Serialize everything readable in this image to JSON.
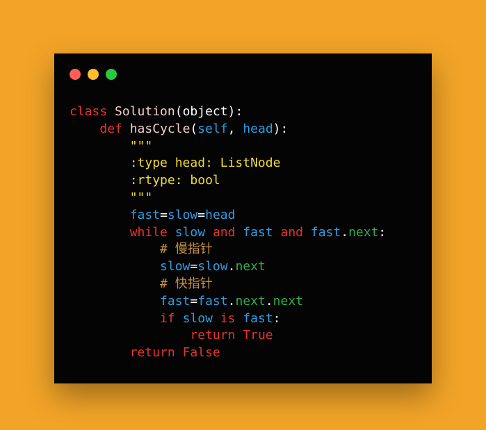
{
  "colors": {
    "background": "#f2a428",
    "window": "#050404",
    "dot_red": "#ff5f57",
    "dot_yellow": "#febc2e",
    "dot_green": "#28c840"
  },
  "code_lines": [
    [
      "class",
      " ",
      "Solution",
      "(",
      "object",
      "):"
    ],
    [
      "    ",
      "def",
      " ",
      "hasCycle",
      "(",
      "self",
      ", ",
      "head",
      "):"
    ],
    [
      "        ",
      "\"\"\""
    ],
    [
      "        ",
      ":type head: ListNode"
    ],
    [
      "        ",
      ":rtype: bool"
    ],
    [
      "        ",
      "\"\"\""
    ],
    [
      "        ",
      "fast",
      "=",
      "slow",
      "=",
      "head"
    ],
    [
      "        ",
      "while",
      " ",
      "slow",
      " ",
      "and",
      " ",
      "fast",
      " ",
      "and",
      " ",
      "fast",
      ".",
      "next",
      ":"
    ],
    [
      "            ",
      "# 慢指针"
    ],
    [
      "            ",
      "slow",
      "=",
      "slow",
      ".",
      "next"
    ],
    [
      "            ",
      "# 快指针"
    ],
    [
      "            ",
      "fast",
      "=",
      "fast",
      ".",
      "next",
      ".",
      "next"
    ],
    [
      "            ",
      "if",
      " ",
      "slow",
      " ",
      "is",
      " ",
      "fast",
      ":"
    ],
    [
      "                ",
      "return",
      " ",
      "True"
    ],
    [
      "        ",
      "return",
      " ",
      "False"
    ]
  ]
}
